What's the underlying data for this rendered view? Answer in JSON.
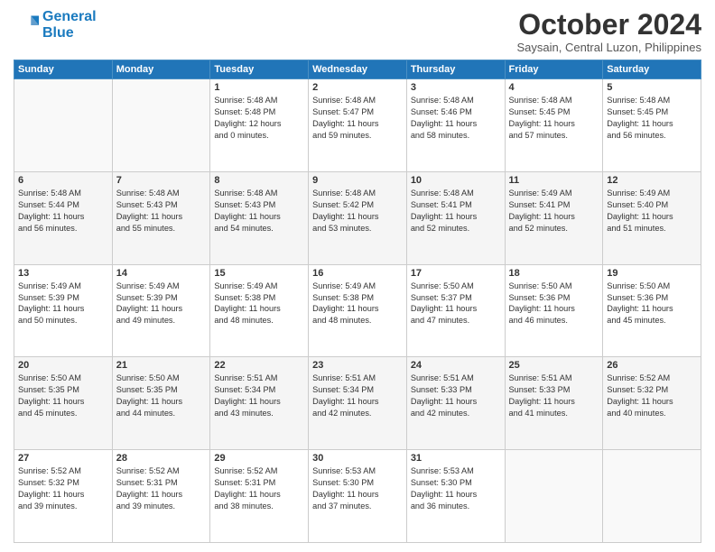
{
  "logo": {
    "line1": "General",
    "line2": "Blue"
  },
  "header": {
    "month": "October 2024",
    "location": "Saysain, Central Luzon, Philippines"
  },
  "days_of_week": [
    "Sunday",
    "Monday",
    "Tuesday",
    "Wednesday",
    "Thursday",
    "Friday",
    "Saturday"
  ],
  "weeks": [
    [
      {
        "day": "",
        "detail": ""
      },
      {
        "day": "",
        "detail": ""
      },
      {
        "day": "1",
        "detail": "Sunrise: 5:48 AM\nSunset: 5:48 PM\nDaylight: 12 hours\nand 0 minutes."
      },
      {
        "day": "2",
        "detail": "Sunrise: 5:48 AM\nSunset: 5:47 PM\nDaylight: 11 hours\nand 59 minutes."
      },
      {
        "day": "3",
        "detail": "Sunrise: 5:48 AM\nSunset: 5:46 PM\nDaylight: 11 hours\nand 58 minutes."
      },
      {
        "day": "4",
        "detail": "Sunrise: 5:48 AM\nSunset: 5:45 PM\nDaylight: 11 hours\nand 57 minutes."
      },
      {
        "day": "5",
        "detail": "Sunrise: 5:48 AM\nSunset: 5:45 PM\nDaylight: 11 hours\nand 56 minutes."
      }
    ],
    [
      {
        "day": "6",
        "detail": "Sunrise: 5:48 AM\nSunset: 5:44 PM\nDaylight: 11 hours\nand 56 minutes."
      },
      {
        "day": "7",
        "detail": "Sunrise: 5:48 AM\nSunset: 5:43 PM\nDaylight: 11 hours\nand 55 minutes."
      },
      {
        "day": "8",
        "detail": "Sunrise: 5:48 AM\nSunset: 5:43 PM\nDaylight: 11 hours\nand 54 minutes."
      },
      {
        "day": "9",
        "detail": "Sunrise: 5:48 AM\nSunset: 5:42 PM\nDaylight: 11 hours\nand 53 minutes."
      },
      {
        "day": "10",
        "detail": "Sunrise: 5:48 AM\nSunset: 5:41 PM\nDaylight: 11 hours\nand 52 minutes."
      },
      {
        "day": "11",
        "detail": "Sunrise: 5:49 AM\nSunset: 5:41 PM\nDaylight: 11 hours\nand 52 minutes."
      },
      {
        "day": "12",
        "detail": "Sunrise: 5:49 AM\nSunset: 5:40 PM\nDaylight: 11 hours\nand 51 minutes."
      }
    ],
    [
      {
        "day": "13",
        "detail": "Sunrise: 5:49 AM\nSunset: 5:39 PM\nDaylight: 11 hours\nand 50 minutes."
      },
      {
        "day": "14",
        "detail": "Sunrise: 5:49 AM\nSunset: 5:39 PM\nDaylight: 11 hours\nand 49 minutes."
      },
      {
        "day": "15",
        "detail": "Sunrise: 5:49 AM\nSunset: 5:38 PM\nDaylight: 11 hours\nand 48 minutes."
      },
      {
        "day": "16",
        "detail": "Sunrise: 5:49 AM\nSunset: 5:38 PM\nDaylight: 11 hours\nand 48 minutes."
      },
      {
        "day": "17",
        "detail": "Sunrise: 5:50 AM\nSunset: 5:37 PM\nDaylight: 11 hours\nand 47 minutes."
      },
      {
        "day": "18",
        "detail": "Sunrise: 5:50 AM\nSunset: 5:36 PM\nDaylight: 11 hours\nand 46 minutes."
      },
      {
        "day": "19",
        "detail": "Sunrise: 5:50 AM\nSunset: 5:36 PM\nDaylight: 11 hours\nand 45 minutes."
      }
    ],
    [
      {
        "day": "20",
        "detail": "Sunrise: 5:50 AM\nSunset: 5:35 PM\nDaylight: 11 hours\nand 45 minutes."
      },
      {
        "day": "21",
        "detail": "Sunrise: 5:50 AM\nSunset: 5:35 PM\nDaylight: 11 hours\nand 44 minutes."
      },
      {
        "day": "22",
        "detail": "Sunrise: 5:51 AM\nSunset: 5:34 PM\nDaylight: 11 hours\nand 43 minutes."
      },
      {
        "day": "23",
        "detail": "Sunrise: 5:51 AM\nSunset: 5:34 PM\nDaylight: 11 hours\nand 42 minutes."
      },
      {
        "day": "24",
        "detail": "Sunrise: 5:51 AM\nSunset: 5:33 PM\nDaylight: 11 hours\nand 42 minutes."
      },
      {
        "day": "25",
        "detail": "Sunrise: 5:51 AM\nSunset: 5:33 PM\nDaylight: 11 hours\nand 41 minutes."
      },
      {
        "day": "26",
        "detail": "Sunrise: 5:52 AM\nSunset: 5:32 PM\nDaylight: 11 hours\nand 40 minutes."
      }
    ],
    [
      {
        "day": "27",
        "detail": "Sunrise: 5:52 AM\nSunset: 5:32 PM\nDaylight: 11 hours\nand 39 minutes."
      },
      {
        "day": "28",
        "detail": "Sunrise: 5:52 AM\nSunset: 5:31 PM\nDaylight: 11 hours\nand 39 minutes."
      },
      {
        "day": "29",
        "detail": "Sunrise: 5:52 AM\nSunset: 5:31 PM\nDaylight: 11 hours\nand 38 minutes."
      },
      {
        "day": "30",
        "detail": "Sunrise: 5:53 AM\nSunset: 5:30 PM\nDaylight: 11 hours\nand 37 minutes."
      },
      {
        "day": "31",
        "detail": "Sunrise: 5:53 AM\nSunset: 5:30 PM\nDaylight: 11 hours\nand 36 minutes."
      },
      {
        "day": "",
        "detail": ""
      },
      {
        "day": "",
        "detail": ""
      }
    ]
  ]
}
